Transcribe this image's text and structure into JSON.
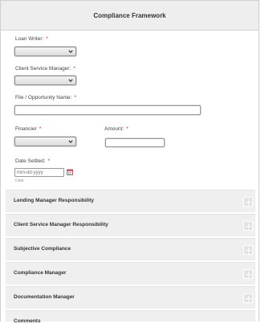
{
  "form": {
    "title": "Compliance Framework",
    "required_marker": "*"
  },
  "fields": {
    "loan_writer": {
      "label": "Loan Writer:",
      "value": ""
    },
    "client_service_manager": {
      "label": "Client Service Manager:",
      "value": ""
    },
    "file_opportunity_name": {
      "label": "File / Opportunity Name:",
      "value": ""
    },
    "financier": {
      "label": "Financier",
      "value": ""
    },
    "amount": {
      "label": "Amount:",
      "value": ""
    },
    "date_settled": {
      "label": "Date Settled:",
      "placeholder": "mm-dd-yyyy",
      "sublabel": "Date"
    }
  },
  "sections": [
    {
      "title": "Lending Manager Responsibility"
    },
    {
      "title": "Client Service Manager Responsibility"
    },
    {
      "title": "Subjective Compliance"
    },
    {
      "title": "Compliance Manager"
    },
    {
      "title": "Documentation Manager"
    },
    {
      "title": "Comments"
    }
  ]
}
